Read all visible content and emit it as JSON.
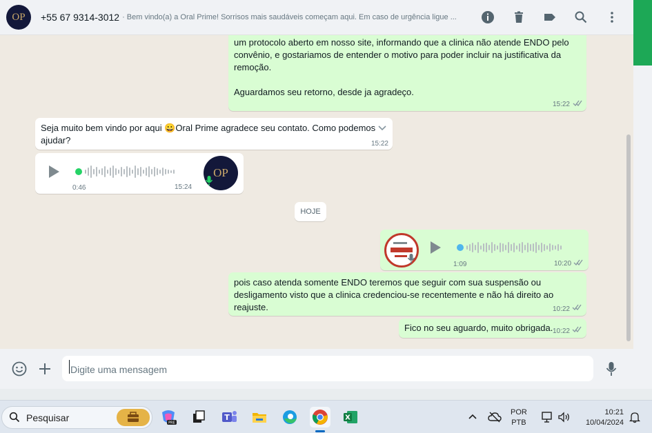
{
  "header": {
    "avatar_text": "OP",
    "contact": "+55 67 9314-3012",
    "status": "· Bem vindo(a) a Oral Prime! Sorrisos mais saudáveis começam aqui. Em caso de urgência ligue ..."
  },
  "messages": [
    {
      "id": "m1",
      "direction": "out",
      "text_lines": [
        "um protocolo aberto em nosso site, informando que a clinica não atende ENDO pelo",
        "convênio, e gostariamos de entender o motivo para poder incluir na justificativa da",
        "remoção."
      ],
      "text2": "Aguardamos seu retorno, desde ja agradeço.",
      "time": "15:22"
    },
    {
      "id": "m2",
      "direction": "in",
      "text_before_emoji": "Seja muito bem vindo por aqui ",
      "emoji": "😀",
      "text_after_emoji": "Oral Prime agradece seu contato. Como podemos",
      "text_line2": "ajudar?",
      "time": "15:22"
    },
    {
      "id": "m3",
      "direction": "in",
      "type": "voice",
      "duration": "0:46",
      "time": "15:24",
      "avatar_text": "OP"
    },
    {
      "id": "m4",
      "direction": "out",
      "type": "voice",
      "duration": "1:09",
      "time": "10:20"
    },
    {
      "id": "m5",
      "direction": "out",
      "text_lines": [
        "pois caso atenda somente ENDO teremos que seguir com sua suspensão ou",
        "desligamento visto que a clinica credenciou-se recentemente e não há direito ao reajuste."
      ],
      "time": "10:22"
    },
    {
      "id": "m6",
      "direction": "out",
      "text": "Fico no seu aguardo, muito obrigada.",
      "time": "10:22"
    }
  ],
  "date_chip": "HOJE",
  "composer": {
    "placeholder": "Digite uma mensagem"
  },
  "taskbar": {
    "search_placeholder": "Pesquisar",
    "lang_line1": "POR",
    "lang_line2": "PTB",
    "time": "10:21",
    "date": "10/04/2024"
  },
  "colors": {
    "outgoing_bubble": "#d9fdd3",
    "incoming_bubble": "#ffffff",
    "chat_bg": "#efeae2",
    "accent_green": "#25d366"
  }
}
